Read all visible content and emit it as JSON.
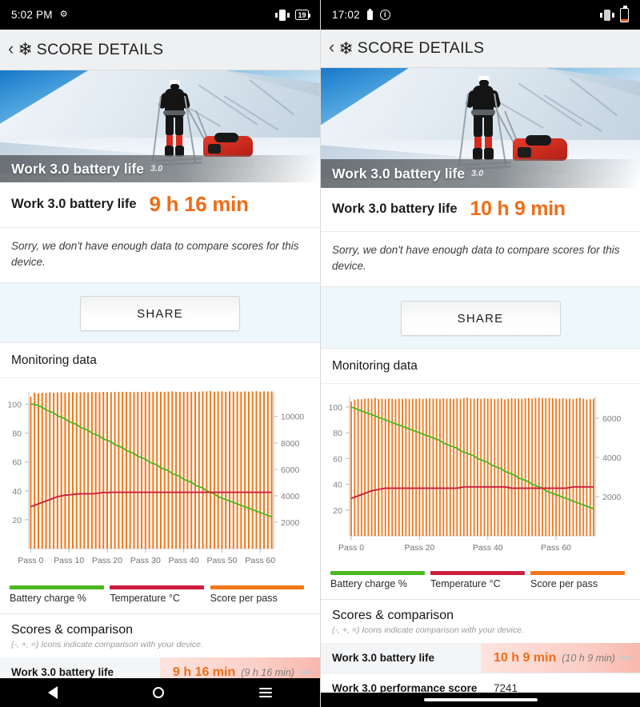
{
  "left": {
    "status_bar": {
      "time": "5:02 PM",
      "alarm_icon": "alarm-icon",
      "vibrate_icon": "vibrate-icon",
      "battery_icon": "battery-icon",
      "battery_percent": "19"
    },
    "app_bar": {
      "back_icon": "back-chevron-icon",
      "logo_icon": "snowflake-icon",
      "title": "SCORE DETAILS"
    },
    "hero": {
      "caption": "Work 3.0 battery life",
      "version": "3.0"
    },
    "score": {
      "label": "Work 3.0 battery life",
      "value": "9 h 16 min"
    },
    "note": "Sorry, we don't have enough data to compare scores for this device.",
    "share_label": "SHARE",
    "monitoring_title": "Monitoring data",
    "legend": [
      {
        "name": "Battery charge %",
        "color": "#4cb820"
      },
      {
        "name": "Temperature °C",
        "color": "#cc1e3c"
      },
      {
        "name": "Score per pass",
        "color": "#f2761a"
      }
    ],
    "scores_comparison": {
      "title": "Scores & comparison",
      "subtitle": "(-, +, =) Icons indicate comparison with your device."
    },
    "rows": [
      {
        "name": "Work 3.0 battery life",
        "value": "9 h 16 min",
        "paren": "(9 h 16 min)",
        "mark": "="
      }
    ],
    "nav": {
      "back": "back-nav-icon",
      "home": "home-nav-icon",
      "recents": "recents-nav-icon"
    },
    "chart_data": {
      "type": "bar",
      "title": "Monitoring data",
      "xlabel": "",
      "ylabel": "Battery charge %",
      "y2label": "Score per pass",
      "ylim": [
        0,
        108
      ],
      "y2lim": [
        0,
        11800
      ],
      "yticks": [
        20,
        40,
        60,
        80,
        100
      ],
      "y2ticks": [
        2000,
        4000,
        6000,
        8000,
        10000
      ],
      "xticks": [
        "Pass 0",
        "Pass 10",
        "Pass 20",
        "Pass 30",
        "Pass 40",
        "Pass 50",
        "Pass 60"
      ],
      "grid": false,
      "legend_position": "bottom",
      "n_passes": 64,
      "series": [
        {
          "name": "Score per pass",
          "type": "bar",
          "color": "#f2761a",
          "axis": "right",
          "values": [
            11500,
            11800,
            11750,
            11800,
            11790,
            11830,
            11800,
            11820,
            11840,
            11800,
            11830,
            11850,
            11800,
            11830,
            11840,
            11820,
            11850,
            11840,
            11830,
            11860,
            11850,
            11840,
            11860,
            11850,
            11870,
            11850,
            11860,
            11840,
            11860,
            11850,
            11870,
            11860,
            11850,
            11880,
            11870,
            11860,
            11880,
            11900,
            11870,
            11860,
            11850,
            11870,
            11860,
            11880,
            11870,
            11890,
            11900,
            11930,
            11880,
            11900,
            11890,
            11870,
            11900,
            11880,
            11890,
            11870,
            11900,
            11880,
            11890,
            11920,
            11880,
            11900,
            11890,
            11900
          ]
        },
        {
          "name": "Battery charge %",
          "type": "line",
          "color": "#4cb820",
          "axis": "left",
          "values": [
            100,
            100,
            99,
            98,
            96,
            95,
            94,
            92,
            91,
            90,
            88,
            87,
            86,
            84,
            83,
            82,
            80,
            79,
            78,
            76,
            75,
            74,
            72,
            71,
            70,
            68,
            67,
            66,
            64,
            63,
            62,
            60,
            59,
            58,
            56,
            55,
            54,
            52,
            51,
            50,
            48,
            47,
            46,
            44,
            43,
            42,
            40,
            39,
            38,
            36,
            35,
            34,
            33,
            32,
            31,
            30,
            29,
            28,
            27,
            26,
            25,
            24,
            23,
            22
          ]
        },
        {
          "name": "Temperature °C",
          "type": "line",
          "color": "#cc1e3c",
          "axis": "left",
          "values": [
            29,
            30,
            31,
            32,
            33,
            34,
            35,
            36,
            36.5,
            37,
            37.2,
            37.5,
            37.8,
            38,
            38,
            38,
            38,
            38.2,
            38.5,
            39,
            38.8,
            39,
            39,
            39,
            39,
            39,
            39,
            39,
            39,
            39,
            39,
            39,
            39,
            39,
            39,
            39,
            39,
            39,
            39,
            39,
            39,
            39,
            39,
            39,
            39,
            39,
            39,
            39,
            39,
            39,
            39,
            39,
            39,
            39,
            39,
            39,
            39,
            39,
            39,
            39,
            39,
            39,
            39,
            39
          ]
        }
      ]
    }
  },
  "right": {
    "status_bar": {
      "time": "17:02",
      "battery_small_icon": "battery-small-icon",
      "info_icon": "info-circle-icon",
      "vibrate_icon": "vibrate-icon",
      "battery_icon": "battery-low-icon"
    },
    "app_bar": {
      "back_icon": "back-chevron-icon",
      "logo_icon": "snowflake-icon",
      "title": "SCORE DETAILS"
    },
    "hero": {
      "caption": "Work 3.0 battery life",
      "version": "3.0"
    },
    "score": {
      "label": "Work 3.0 battery life",
      "value": "10 h 9 min"
    },
    "note": "Sorry, we don't have enough data to compare scores for this device.",
    "share_label": "SHARE",
    "monitoring_title": "Monitoring data",
    "legend": [
      {
        "name": "Battery charge %",
        "color": "#4cb820"
      },
      {
        "name": "Temperature °C",
        "color": "#cc1e3c"
      },
      {
        "name": "Score per pass",
        "color": "#f2761a"
      }
    ],
    "scores_comparison": {
      "title": "Scores & comparison",
      "subtitle": "(-, +, =) Icons indicate comparison with your device."
    },
    "rows": [
      {
        "name": "Work 3.0 battery life",
        "value": "10 h 9 min",
        "paren": "(10 h 9 min)",
        "mark": "="
      },
      {
        "name": "Work 3.0 performance score",
        "value": "7241",
        "paren": "",
        "mark": ""
      }
    ],
    "nav": {
      "pill": "home-pill-indicator"
    },
    "chart_data": {
      "type": "bar",
      "title": "Monitoring data",
      "xlabel": "",
      "ylabel": "Battery charge %",
      "y2label": "Score per pass",
      "ylim": [
        0,
        108
      ],
      "y2lim": [
        0,
        7100
      ],
      "yticks": [
        20,
        40,
        60,
        80,
        100
      ],
      "y2ticks": [
        2000,
        4000,
        6000
      ],
      "xticks": [
        "Pass 0",
        "Pass 20",
        "Pass 40",
        "Pass 60"
      ],
      "grid": false,
      "legend_position": "bottom",
      "n_passes": 72,
      "series": [
        {
          "name": "Score per pass",
          "type": "bar",
          "color": "#f2761a",
          "axis": "right",
          "values": [
            6850,
            6950,
            6990,
            6980,
            7000,
            7010,
            6990,
            7040,
            6990,
            7000,
            6980,
            7010,
            6990,
            6970,
            7000,
            6990,
            7010,
            6980,
            7000,
            6990,
            7010,
            6980,
            7000,
            7020,
            7000,
            7010,
            6990,
            7020,
            7000,
            7010,
            6990,
            7020,
            7000,
            7030,
            7040,
            7010,
            7000,
            7020,
            6990,
            7020,
            7000,
            7010,
            6980,
            7000,
            7020,
            6960,
            7000,
            7020,
            7000,
            7010,
            6990,
            7020,
            7030,
            7000,
            7040,
            7050,
            7030,
            7020,
            7040,
            7030,
            7010,
            7000,
            7020,
            7000,
            7010,
            6990,
            7020,
            7040,
            7000,
            6950,
            6980,
            7000
          ]
        },
        {
          "name": "Battery charge %",
          "type": "line",
          "color": "#4cb820",
          "axis": "left",
          "values": [
            100,
            99,
            98,
            97,
            96,
            95,
            94,
            93,
            92,
            91,
            90,
            89,
            88,
            87,
            86,
            85,
            84,
            83,
            82,
            81,
            80,
            79,
            78,
            77,
            76,
            75,
            74,
            72,
            71,
            70,
            69,
            68,
            66,
            65,
            64,
            63,
            62,
            60,
            59,
            58,
            57,
            55,
            54,
            53,
            52,
            50,
            49,
            48,
            47,
            45,
            44,
            43,
            42,
            40,
            39,
            38,
            37,
            35,
            34,
            33,
            32,
            31,
            30,
            29,
            28,
            27,
            26,
            25,
            24,
            23,
            22,
            21
          ]
        },
        {
          "name": "Temperature °C",
          "type": "line",
          "color": "#cc1e3c",
          "axis": "left",
          "values": [
            29,
            30,
            31,
            32,
            33,
            34,
            35,
            35.5,
            36,
            36.5,
            37,
            37,
            37,
            37,
            37,
            37,
            37,
            37,
            37,
            37,
            37,
            37,
            37,
            37,
            37,
            37,
            37,
            37,
            37,
            37,
            37,
            37,
            37.5,
            38,
            38,
            38,
            38,
            38,
            38,
            38,
            38,
            38,
            38,
            38,
            38,
            38,
            37.5,
            37,
            37,
            37,
            37,
            37,
            37,
            37,
            37,
            37,
            37,
            37,
            37,
            37,
            37,
            37,
            37,
            37,
            37.5,
            38,
            38,
            38,
            38,
            38,
            38,
            38
          ]
        }
      ]
    }
  }
}
